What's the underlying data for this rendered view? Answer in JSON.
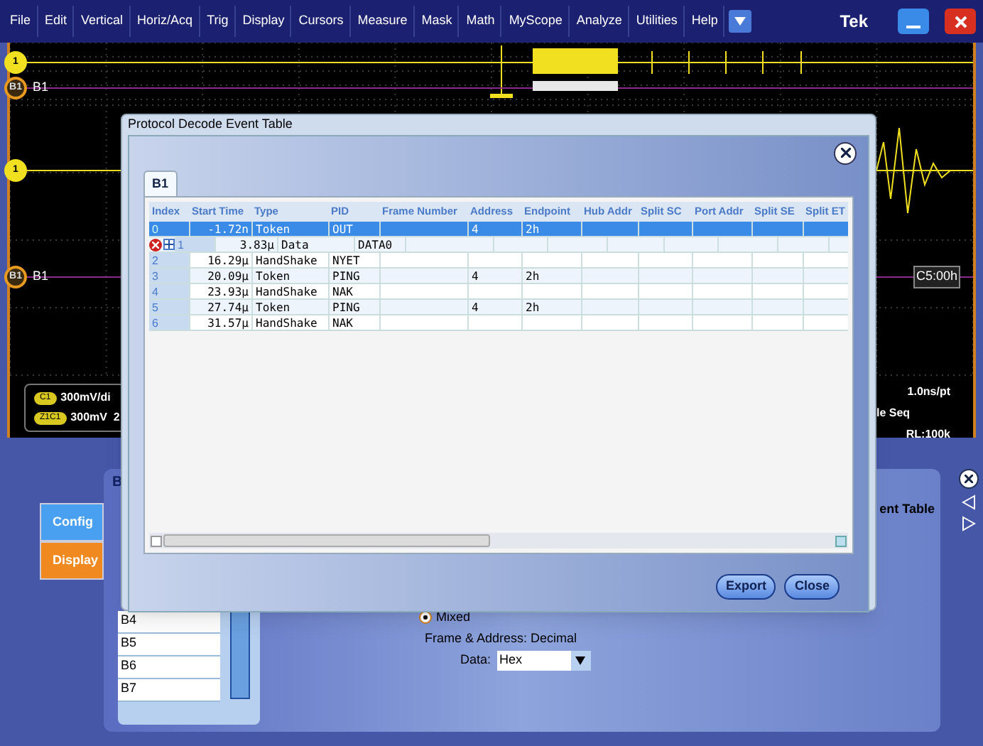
{
  "menu": [
    "File",
    "Edit",
    "Vertical",
    "Horiz/Acq",
    "Trig",
    "Display",
    "Cursors",
    "Measure",
    "Mask",
    "Math",
    "MyScope",
    "Analyze",
    "Utilities",
    "Help"
  ],
  "brand": "Tek",
  "scope": {
    "top_channel_marker": "1",
    "top_bus_marker": "B1",
    "top_bus_label": "B1",
    "channel_marker": "1",
    "bus_marker": "B1",
    "bus_label": "B1",
    "bus_value": "C5:00h"
  },
  "readouts": {
    "left": [
      {
        "badge": "C1",
        "text": "300mV/di"
      },
      {
        "badge": "Z1C1",
        "text": "300mV  2"
      }
    ],
    "right": [
      "1.0ns/pt",
      "le Seq",
      "RL:100k"
    ]
  },
  "panel": {
    "heading": "B",
    "tabs": [
      {
        "label": "Config",
        "selected": false
      },
      {
        "label": "Display",
        "selected": true
      }
    ],
    "buses": [
      "B4",
      "B5",
      "B6",
      "B7"
    ],
    "right_title": "ent Table",
    "radio": {
      "label": "Mixed",
      "selected": true
    },
    "format_note": "Frame & Address: Decimal",
    "data_label": "Data:",
    "data_value": "Hex"
  },
  "dialog": {
    "title": "Protocol Decode Event Table",
    "tab": "B1",
    "columns": [
      "Index",
      "Start Time",
      "Type",
      "PID",
      "Frame Number",
      "Address",
      "Endpoint",
      "Hub Addr",
      "Split SC",
      "Port Addr",
      "Split SE",
      "Split ET"
    ],
    "rows": [
      {
        "index": "0",
        "start_time": "-1.72n",
        "type": "Token",
        "pid": "OUT",
        "address": "4",
        "endpoint": "2h",
        "selected": true,
        "error": false,
        "expandable": false
      },
      {
        "index": "1",
        "start_time": "3.83µ",
        "type": "Data",
        "pid": "DATA0",
        "selected": false,
        "error": true,
        "expandable": true
      },
      {
        "index": "2",
        "start_time": "16.29µ",
        "type": "HandShake",
        "pid": "NYET",
        "selected": false,
        "error": false,
        "expandable": false
      },
      {
        "index": "3",
        "start_time": "20.09µ",
        "type": "Token",
        "pid": "PING",
        "address": "4",
        "endpoint": "2h",
        "selected": false,
        "error": false,
        "expandable": false
      },
      {
        "index": "4",
        "start_time": "23.93µ",
        "type": "HandShake",
        "pid": "NAK",
        "selected": false,
        "error": false,
        "expandable": false
      },
      {
        "index": "5",
        "start_time": "27.74µ",
        "type": "Token",
        "pid": "PING",
        "address": "4",
        "endpoint": "2h",
        "selected": false,
        "error": false,
        "expandable": false
      },
      {
        "index": "6",
        "start_time": "31.57µ",
        "type": "HandShake",
        "pid": "NAK",
        "selected": false,
        "error": false,
        "expandable": false
      }
    ],
    "buttons": [
      "Export",
      "Close"
    ]
  }
}
